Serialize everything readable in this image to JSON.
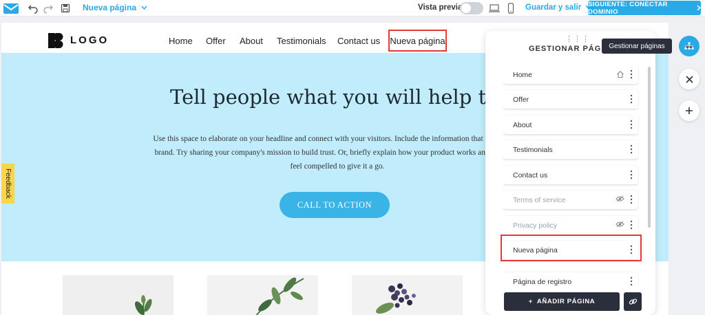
{
  "toolbar": {
    "current_page": "Nueva página",
    "preview_label": "Vista previa",
    "save_label": "Guardar y salir",
    "next_label": "SIGUIENTE: CONECTAR DOMINIO"
  },
  "site": {
    "logo_text": "LOGO",
    "nav": [
      "Home",
      "Offer",
      "About",
      "Testimonials",
      "Contact us",
      "Nueva página"
    ],
    "hero_title": "Tell people what you will help them d",
    "hero_body": [
      "Use this space to elaborate on your headline and connect with your visitors. Include the information that makes the r",
      "brand. Try sharing your company's mission to build trust. Or, briefly explain how your product works and the value",
      "feel compelled to give it a go."
    ],
    "cta_label": "CALL TO ACTION",
    "feedback_label": "Feedback"
  },
  "panel": {
    "title": "GESTIONAR PÁGINAS",
    "pages": [
      {
        "label": "Home",
        "state": "home"
      },
      {
        "label": "Offer",
        "state": "normal"
      },
      {
        "label": "About",
        "state": "normal"
      },
      {
        "label": "Testimonials",
        "state": "normal"
      },
      {
        "label": "Contact us",
        "state": "normal"
      },
      {
        "label": "Terms of service",
        "state": "hidden"
      },
      {
        "label": "Privacy policy",
        "state": "hidden"
      },
      {
        "label": "Nueva página",
        "state": "highlighted"
      },
      {
        "label": "Página de registro",
        "state": "normal"
      }
    ],
    "add_label": "AÑADIR PÁGINA"
  },
  "tooltip": "Gestionar páginas",
  "colors": {
    "accent": "#29a9e6",
    "hero_bg": "#c0ecfb",
    "highlight": "#e53935",
    "dark_button": "#2a2f3b"
  }
}
